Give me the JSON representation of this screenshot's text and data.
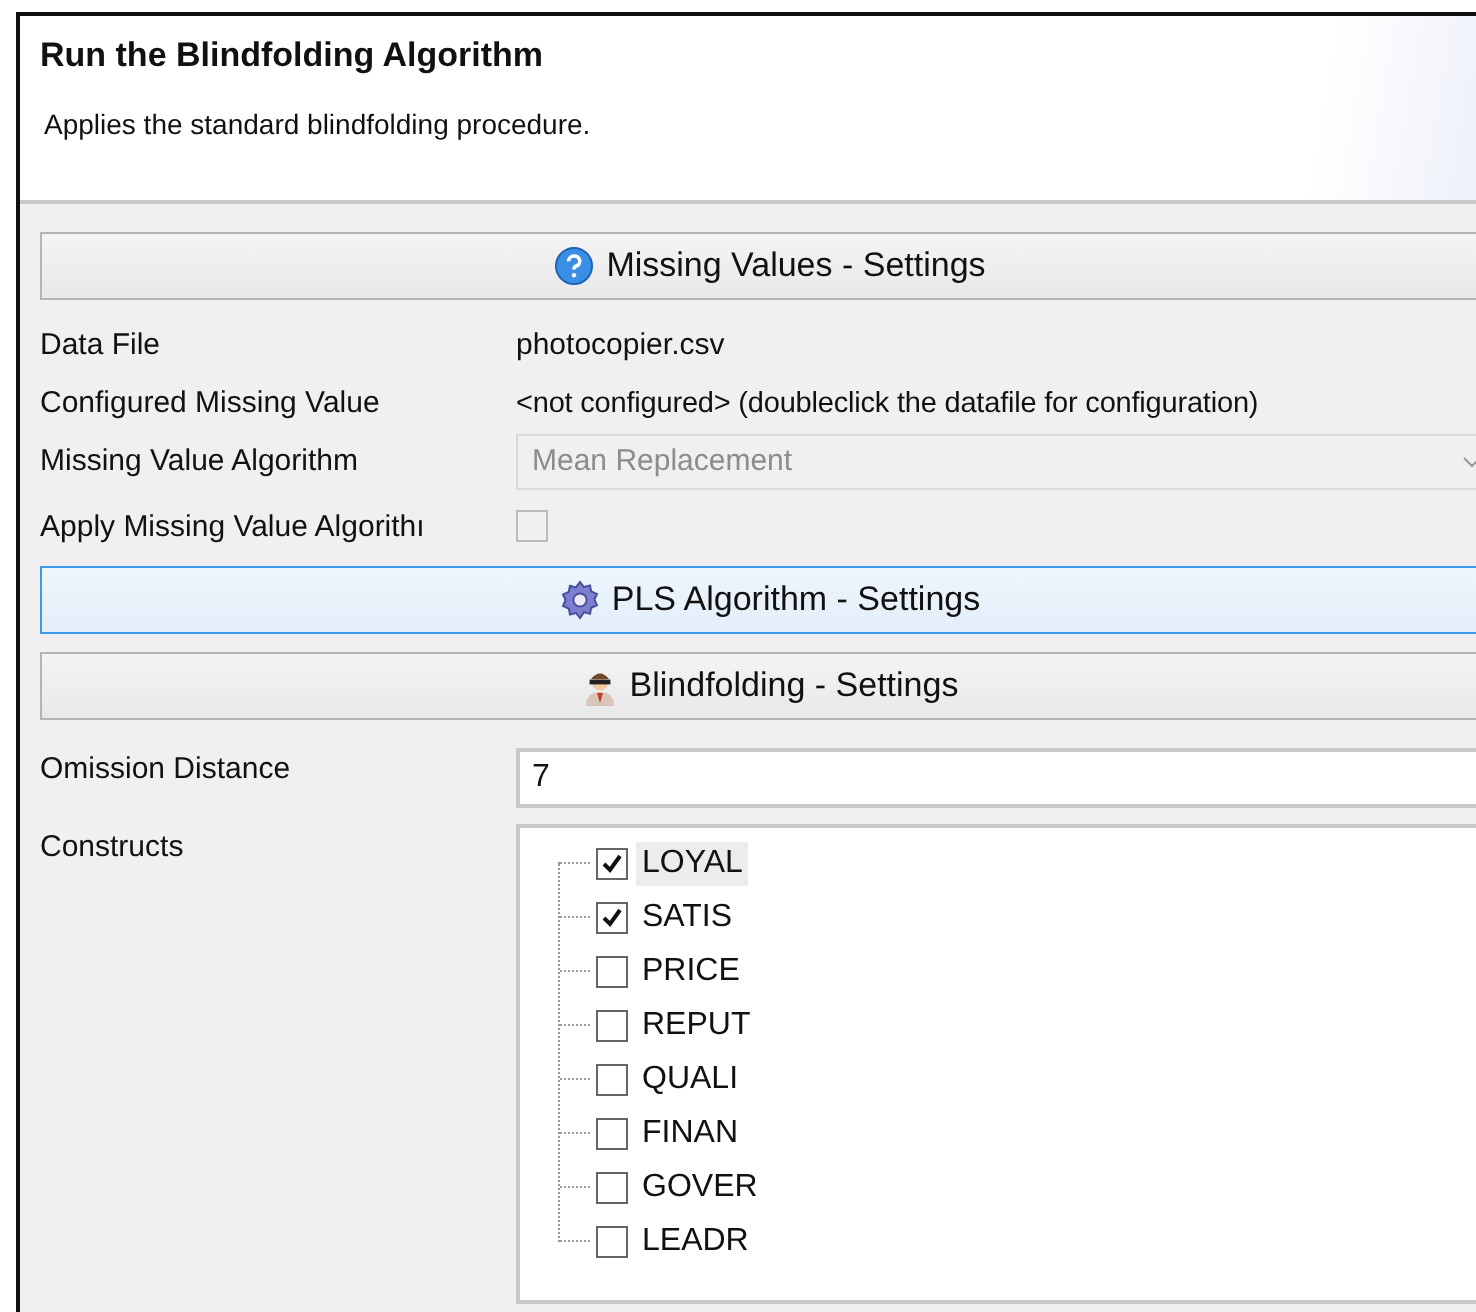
{
  "header": {
    "title": "Run the Blindfolding Algorithm",
    "description": "Applies the standard blindfolding procedure."
  },
  "missing_values": {
    "button": {
      "label": "Missing Values - Settings",
      "focused": false
    },
    "data_file": {
      "label": "Data File",
      "value": "photocopier.csv"
    },
    "configured": {
      "label": "Configured Missing Value",
      "value": "<not configured> (doubleclick the datafile for configuration)"
    },
    "algorithm": {
      "label": "Missing Value Algorithm",
      "value": "Mean Replacement",
      "disabled": true
    },
    "apply": {
      "label": "Apply Missing Value Algorithı",
      "checked": false,
      "disabled": true
    }
  },
  "pls_button": {
    "label": "PLS Algorithm - Settings",
    "focused": true
  },
  "blindfolding": {
    "button": {
      "label": "Blindfolding - Settings",
      "focused": false
    },
    "omission": {
      "label": "Omission Distance",
      "value": "7"
    },
    "constructs": {
      "label": "Constructs",
      "items": [
        {
          "label": "LOYAL",
          "checked": true,
          "selected": true
        },
        {
          "label": "SATIS",
          "checked": true,
          "selected": false
        },
        {
          "label": "PRICE",
          "checked": false,
          "selected": false
        },
        {
          "label": "REPUT",
          "checked": false,
          "selected": false
        },
        {
          "label": "QUALI",
          "checked": false,
          "selected": false
        },
        {
          "label": "FINAN",
          "checked": false,
          "selected": false
        },
        {
          "label": "GOVER",
          "checked": false,
          "selected": false
        },
        {
          "label": "LEADR",
          "checked": false,
          "selected": false
        }
      ]
    }
  }
}
